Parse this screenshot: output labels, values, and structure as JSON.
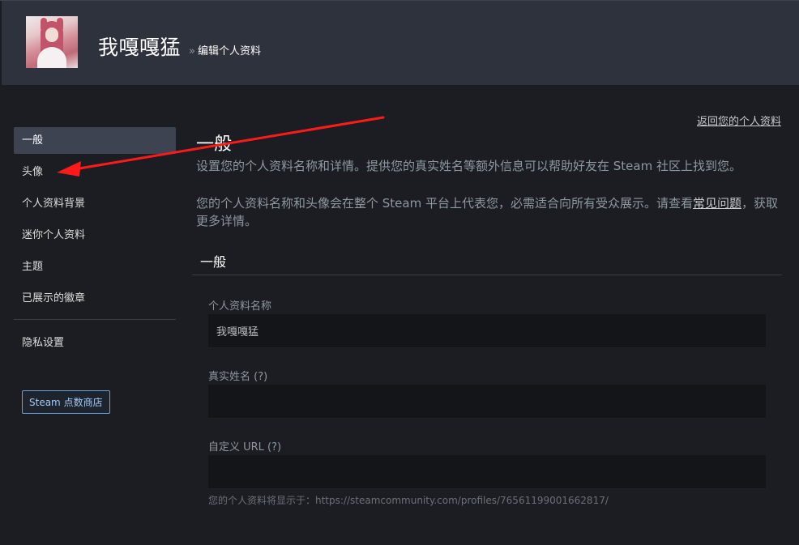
{
  "header": {
    "persona_name": "我嘎嘎猛",
    "separator": "»",
    "breadcrumb": "编辑个人资料"
  },
  "back_link": "返回您的个人资料",
  "sidebar": {
    "items": [
      {
        "label": "一般",
        "active": true
      },
      {
        "label": "头像",
        "active": false
      },
      {
        "label": "个人资料背景",
        "active": false
      },
      {
        "label": "迷你个人资料",
        "active": false
      },
      {
        "label": "主题",
        "active": false
      },
      {
        "label": "已展示的徽章",
        "active": false
      }
    ],
    "privacy_label": "隐私设置",
    "points_shop_label": "Steam 点数商店"
  },
  "main": {
    "title": "一般",
    "desc1": "设置您的个人资料名称和详情。提供您的真实姓名等额外信息可以帮助好友在 Steam 社区上找到您。",
    "desc2_text": "您的个人资料名称和头像会在整个 Steam 平台上代表您，必需适合向所有受众展示。请查看",
    "desc2_link": "常见问题",
    "desc2_tail": "，获取更多详情。",
    "section_title": "一般",
    "fields": {
      "profile_name": {
        "label": "个人资料名称",
        "value": "我嘎嘎猛"
      },
      "real_name": {
        "label": "真实姓名 (?)",
        "value": ""
      },
      "custom_url": {
        "label": "自定义 URL (?)",
        "value": ""
      }
    },
    "url_hint": "您的个人资料将显示于：https://steamcommunity.com/profiles/76561199001662817/"
  },
  "colors": {
    "annotation_arrow": "#ff1a1a",
    "header_bg": "#2e323c",
    "page_bg": "#1b1d22",
    "active_item_bg": "#3d4350",
    "points_button_border": "#66a2d6"
  }
}
